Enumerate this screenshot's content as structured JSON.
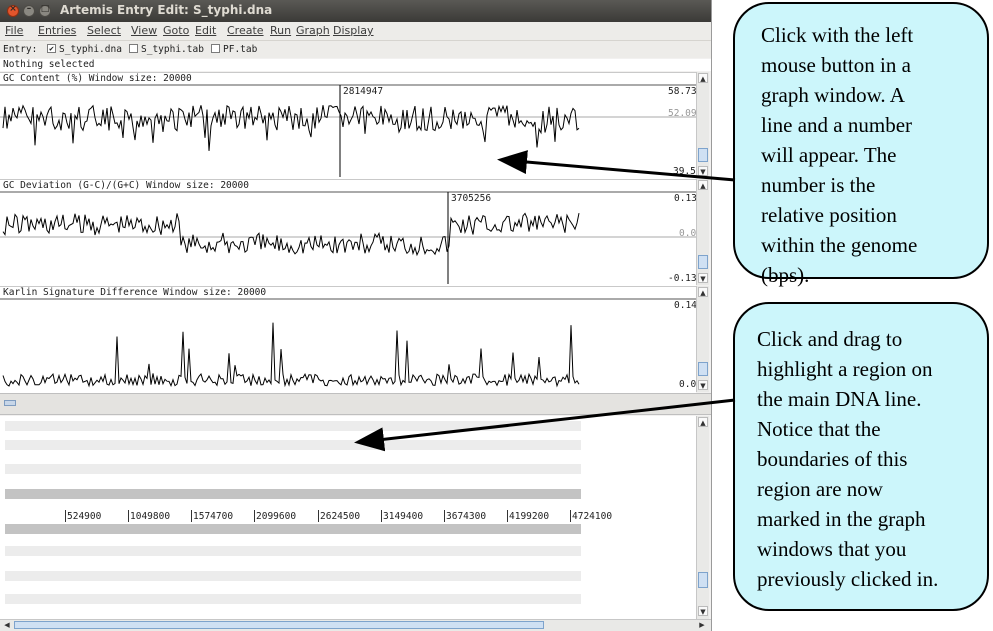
{
  "window": {
    "title": "Artemis Entry Edit: S_typhi.dna"
  },
  "menubar": {
    "items": [
      "File",
      "Entries",
      "Select",
      "View",
      "Goto",
      "Edit",
      "Create",
      "Run",
      "Graph",
      "Display"
    ]
  },
  "entry_bar": {
    "label": "Entry:",
    "entries": [
      {
        "name": "S_typhi.dna",
        "checked": true
      },
      {
        "name": "S_typhi.tab",
        "checked": false
      },
      {
        "name": "PF.tab",
        "checked": false
      }
    ]
  },
  "status": "Nothing selected",
  "graphs": [
    {
      "title": "GC Content (%)  Window size: 20000",
      "max": "58.73",
      "mid": "52.09",
      "min": "39.5",
      "marker": "2814947"
    },
    {
      "title": "GC Deviation (G-C)/(G+C)  Window size: 20000",
      "max": "0.13",
      "mid": "0.0",
      "min": "-0.13",
      "marker": "3705256"
    },
    {
      "title": "Karlin Signature Difference  Window size: 20000",
      "max": "0.14",
      "mid": "",
      "min": "0.0"
    }
  ],
  "ruler_ticks": [
    "524900",
    "1049800",
    "1574700",
    "2099600",
    "2624500",
    "3149400",
    "3674300",
    "4199200",
    "4724100"
  ],
  "callouts": {
    "top_lines": [
      "Click with the left",
      "mouse button in a",
      "graph window. A",
      "line and a number",
      "will appear. The",
      "number is the",
      "relative position",
      "within the genome",
      "(bps)."
    ],
    "bottom_lines": [
      "Click and drag to",
      "highlight a region on",
      "the main DNA line.",
      "Notice that the",
      "boundaries of this",
      "region are now",
      "marked in the graph",
      "windows that you",
      "previously clicked in."
    ]
  },
  "colors": {
    "callout_fill": "#ccf6fb",
    "titlebar": "#3c3b37",
    "close_button": "#e2552c"
  },
  "icons": [
    "close-icon",
    "minimize-icon",
    "maximize-icon",
    "checkbox-icon",
    "scroll-up-icon",
    "scroll-down-icon",
    "pointer-arrow-icon"
  ]
}
